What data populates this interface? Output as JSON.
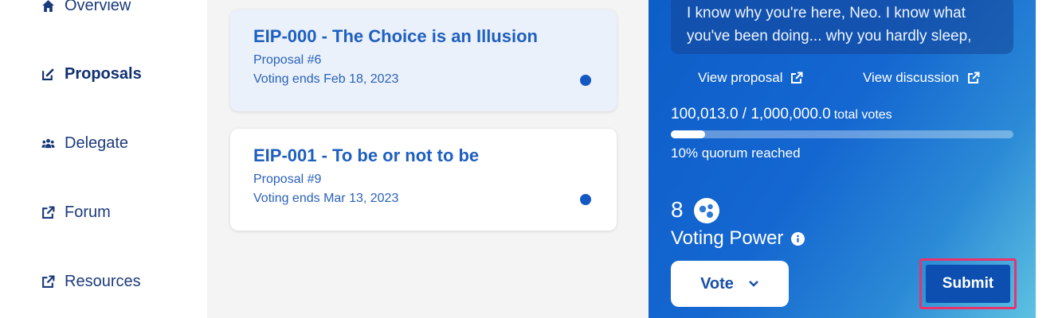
{
  "sidebar": {
    "items": [
      {
        "label": "Overview",
        "icon": "home-icon",
        "active": false
      },
      {
        "label": "Proposals",
        "icon": "external-link-icon",
        "active": true
      },
      {
        "label": "Delegate",
        "icon": "users-icon",
        "active": false
      },
      {
        "label": "Forum",
        "icon": "external-link-icon",
        "active": false
      },
      {
        "label": "Resources",
        "icon": "external-link-icon",
        "active": false
      }
    ]
  },
  "proposals": [
    {
      "title": "EIP-000 - The Choice is an Illusion",
      "number": "Proposal #6",
      "ends": "Voting ends Feb 18, 2023",
      "status_dot": "active-dot"
    },
    {
      "title": "EIP-001 - To be or not to be",
      "number": "Proposal #9",
      "ends": "Voting ends Mar 13, 2023",
      "status_dot": "active-dot"
    }
  ],
  "panel": {
    "description": "I know why you're here, Neo. I know what you've been doing... why you hardly sleep,",
    "view_proposal": "View proposal",
    "view_discussion": "View discussion",
    "votes_cast": "100,013.0 / 1,000,000.0",
    "votes_suffix": "total votes",
    "quorum_fraction": 0.1,
    "quorum_text": "10% quorum reached",
    "voting_power": "8",
    "voting_power_label": "Voting Power",
    "vote_button": "Vote",
    "submit_button": "Submit"
  },
  "colors": {
    "accent": "#1f5fbf",
    "highlight": "#e8336b",
    "panel_start": "#0e5ec8",
    "panel_end": "#5ec2e2"
  }
}
